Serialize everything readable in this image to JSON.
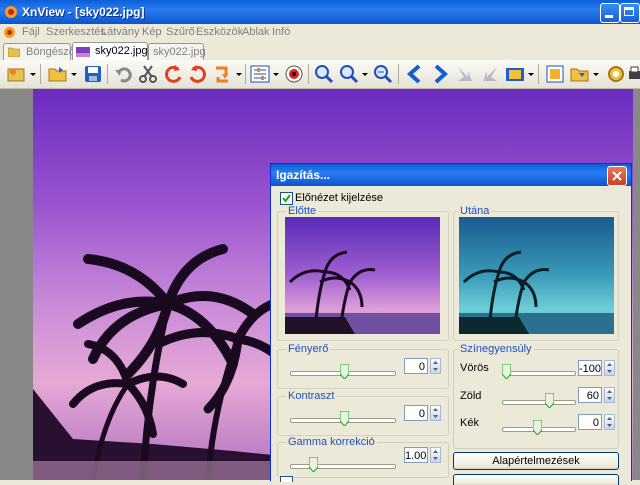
{
  "window": {
    "title": "XnView - [sky022.jpg]"
  },
  "menu": [
    "Fájl",
    "Szerkesztés",
    "Látvány",
    "Kép",
    "Szűrő",
    "Eszközök",
    "Ablak",
    "Infó"
  ],
  "tabs": [
    {
      "label": "Böngésző"
    },
    {
      "label": "sky022.jpg"
    },
    {
      "label": "sky022.jpg"
    }
  ],
  "dialog": {
    "title": "Igazítás...",
    "preview_checkbox": {
      "label": "Előnézet kijelzése",
      "checked": true
    },
    "before_label": "Előtte",
    "after_label": "Utána",
    "brightness": {
      "label": "Fényerő",
      "value": "0"
    },
    "contrast": {
      "label": "Kontraszt",
      "value": "0"
    },
    "gamma": {
      "label": "Gamma korrekció",
      "value": "1.00"
    },
    "color_balance": {
      "label": "Színegyensúly",
      "red": {
        "label": "Vörös",
        "value": "-100"
      },
      "green": {
        "label": "Zöld",
        "value": "60"
      },
      "blue": {
        "label": "Kék",
        "value": "0"
      }
    },
    "reset_button": "Alapértelmezések"
  },
  "colors": {
    "titlebar": "#0a5fd8",
    "group_label": "#2050c0",
    "dialog_bg": "#ece9d8"
  }
}
